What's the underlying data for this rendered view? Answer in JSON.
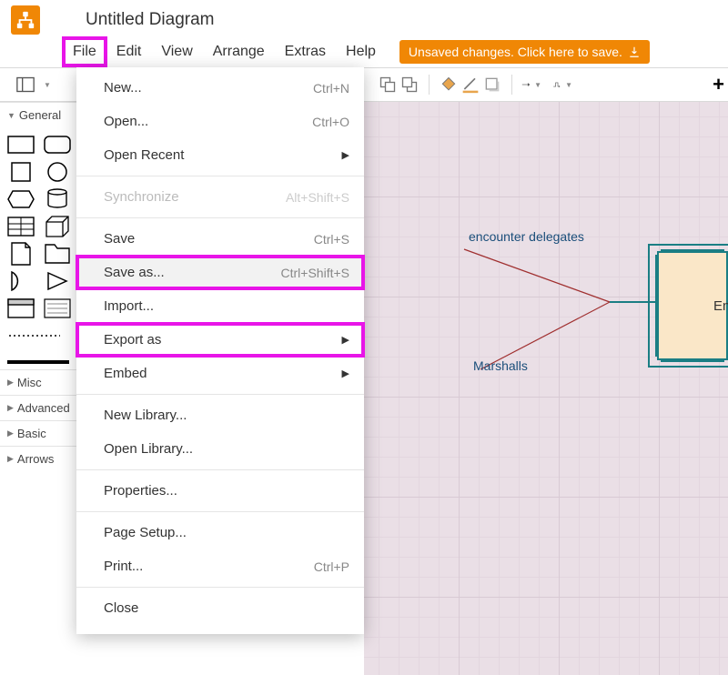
{
  "title": "Untitled Diagram",
  "menubar": {
    "file": "File",
    "edit": "Edit",
    "view": "View",
    "arrange": "Arrange",
    "extras": "Extras",
    "help": "Help"
  },
  "save_banner": "Unsaved changes. Click here to save.",
  "file_menu": {
    "new": {
      "label": "New...",
      "shortcut": "Ctrl+N"
    },
    "open": {
      "label": "Open...",
      "shortcut": "Ctrl+O"
    },
    "open_recent": {
      "label": "Open Recent"
    },
    "synchronize": {
      "label": "Synchronize",
      "shortcut": "Alt+Shift+S"
    },
    "save": {
      "label": "Save",
      "shortcut": "Ctrl+S"
    },
    "save_as": {
      "label": "Save as...",
      "shortcut": "Ctrl+Shift+S"
    },
    "import": {
      "label": "Import..."
    },
    "export_as": {
      "label": "Export as"
    },
    "embed": {
      "label": "Embed"
    },
    "new_library": {
      "label": "New Library..."
    },
    "open_library": {
      "label": "Open Library..."
    },
    "properties": {
      "label": "Properties..."
    },
    "page_setup": {
      "label": "Page Setup..."
    },
    "print": {
      "label": "Print...",
      "shortcut": "Ctrl+P"
    },
    "close": {
      "label": "Close"
    }
  },
  "sidebar": {
    "sections": {
      "general": "General",
      "misc": "Misc",
      "advanced": "Advanced",
      "basic": "Basic",
      "arrows": "Arrows"
    }
  },
  "canvas": {
    "labels": {
      "encounter": "encounter delegates",
      "marshalls": "Marshalls"
    },
    "node_text": "En"
  }
}
